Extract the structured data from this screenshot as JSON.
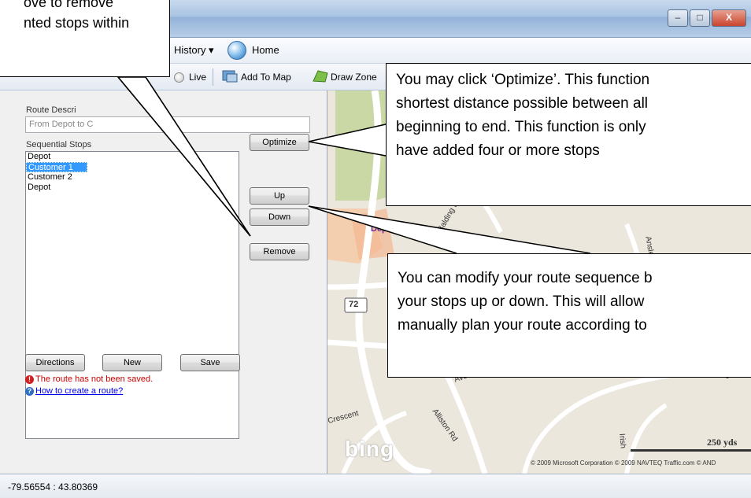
{
  "window": {
    "minimize": "–",
    "maximize": "□",
    "close": "X"
  },
  "menubar": {
    "history": "History ▾",
    "home": "Home"
  },
  "toolbar": {
    "live": "Live",
    "add_to_map": "Add To Map",
    "draw_zone": "Draw Zone"
  },
  "panel": {
    "route_desc_label": "Route Descri",
    "route_desc_value": "From Depot to C",
    "sequential_label": "Sequential Stops",
    "stops": [
      "Depot",
      "Customer 1",
      "Customer 2",
      "Depot"
    ],
    "buttons": {
      "optimize": "Optimize",
      "up": "Up",
      "down": "Down",
      "remove": "Remove",
      "directions": "Directions",
      "new": "New",
      "save": "Save"
    },
    "warning": "The route has not been saved.",
    "help_link": "How to create a route?"
  },
  "map": {
    "depot_label": "Depot",
    "route_shield": "72",
    "streets": [
      "Balding B",
      "Ansley G",
      "Avon Cres",
      "Crescent",
      "Alliston Rd",
      "Lucky",
      "Irish"
    ],
    "brand": "bing",
    "scale": "250 yds",
    "copyright": "© 2009 Microsoft Corporation   © 2009 NAVTEQ   Traffic.com   © AND"
  },
  "status": {
    "coords": "-79.56554 : 43.80369"
  },
  "callouts": {
    "top_left": [
      "ove to remove",
      "nted stops within"
    ],
    "optimize": [
      "You may click ‘Optimize’. This function",
      "shortest distance possible between all",
      "beginning to end. This function is only",
      "have added four or more stops"
    ],
    "updown": [
      "You can modify your route sequence b",
      "your stops up or down. This will allow",
      "manually plan your route according to"
    ]
  },
  "colors": {
    "selection": "#3399ff",
    "warning": "#cc0000",
    "link": "#0000ee",
    "depot": "#6a2a9a"
  }
}
